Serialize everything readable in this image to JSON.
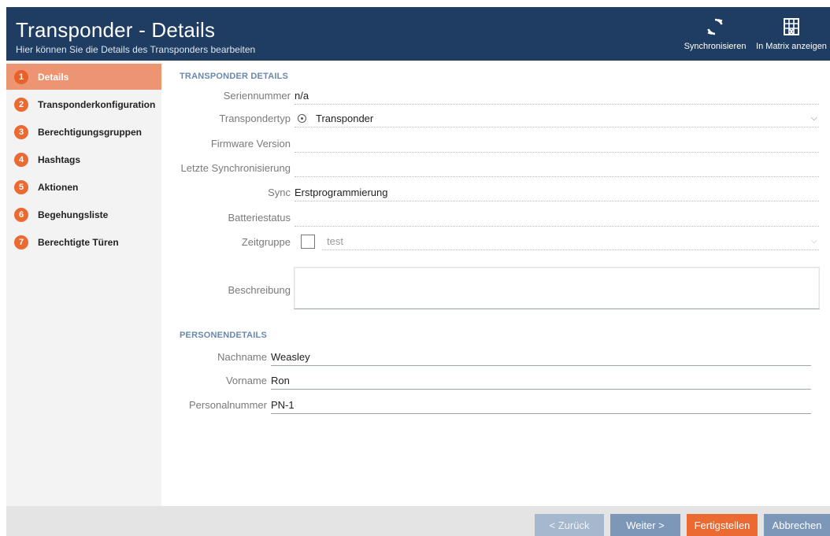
{
  "header": {
    "title": "Transponder - Details",
    "subtitle": "Hier können Sie die Details des Transponders bearbeiten",
    "buttons": {
      "sync_label": "Synchronisieren",
      "sync_icon": "sync-icon",
      "matrix_label": "In Matrix anzeigen",
      "matrix_icon": "matrix-icon"
    }
  },
  "sidebar": {
    "items": [
      {
        "num": "1",
        "label": "Details",
        "active": true
      },
      {
        "num": "2",
        "label": "Transponderkonfiguration"
      },
      {
        "num": "3",
        "label": "Berechtigungsgruppen"
      },
      {
        "num": "4",
        "label": "Hashtags"
      },
      {
        "num": "5",
        "label": "Aktionen"
      },
      {
        "num": "6",
        "label": "Begehungsliste"
      },
      {
        "num": "7",
        "label": "Berechtigte Türen"
      }
    ]
  },
  "transponder_details": {
    "section_title": "TRANSPONDER DETAILS",
    "seriennummer": {
      "label": "Seriennummer",
      "value": "n/a"
    },
    "transpondertyp": {
      "label": "Transpondertyp",
      "value": "Transponder"
    },
    "firmware": {
      "label": "Firmware Version",
      "value": ""
    },
    "letzte_sync": {
      "label": "Letzte Synchronisierung",
      "value": ""
    },
    "sync": {
      "label": "Sync",
      "value": "Erstprogrammierung"
    },
    "batteriestatus": {
      "label": "Batteriestatus",
      "value": ""
    },
    "zeitgruppe": {
      "label": "Zeitgruppe",
      "value": "test",
      "checked": false
    },
    "beschreibung": {
      "label": "Beschreibung",
      "value": ""
    }
  },
  "personendetails": {
    "section_title": "PERSONENDETAILS",
    "nachname": {
      "label": "Nachname",
      "value": "Weasley"
    },
    "vorname": {
      "label": "Vorname",
      "value": "Ron"
    },
    "personalnummer": {
      "label": "Personalnummer",
      "value": "PN-1"
    }
  },
  "footer": {
    "back_label": "< Zurück",
    "next_label": "Weiter >",
    "finish_label": "Fertigstellen",
    "cancel_label": "Abbrechen"
  },
  "colors": {
    "header_bg": "#1f3d63",
    "accent_orange": "#ea6a32",
    "active_step_bg": "#ed9473",
    "section_title": "#6a88ad",
    "button_blue": "#7d97b9"
  }
}
